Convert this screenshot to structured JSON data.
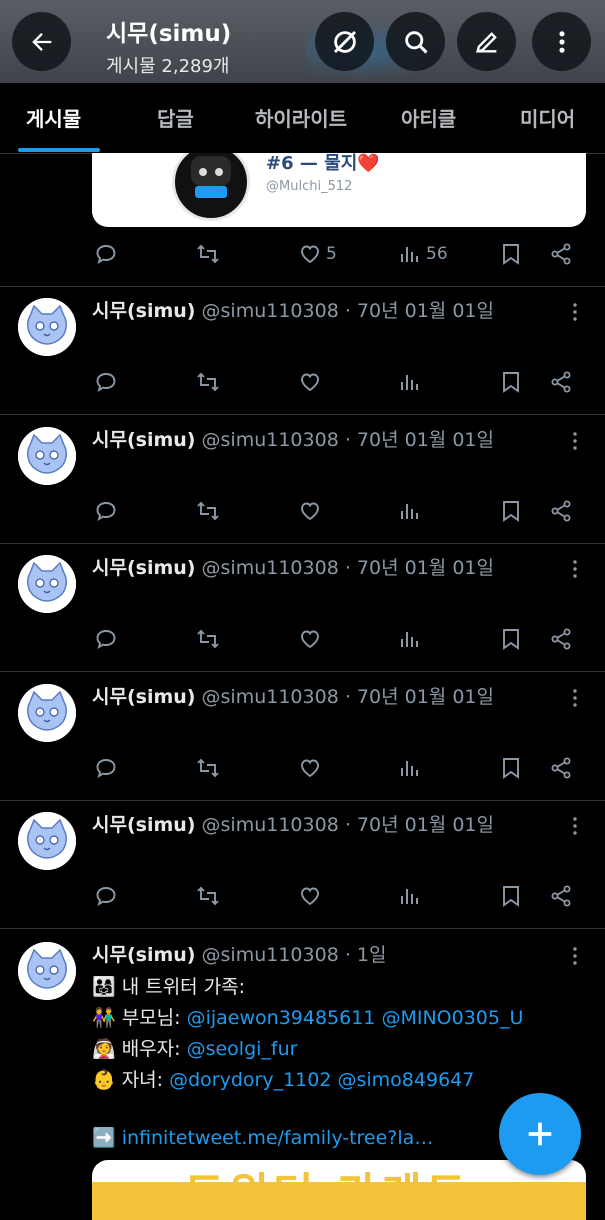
{
  "header": {
    "title": "시무(simu)",
    "post_count": "게시물 2,289개"
  },
  "tabs": [
    {
      "label": "게시물",
      "active": true
    },
    {
      "label": "답글",
      "active": false
    },
    {
      "label": "하이라이트",
      "active": false
    },
    {
      "label": "아티클",
      "active": false
    },
    {
      "label": "미디어",
      "active": false
    }
  ],
  "quoted_card": {
    "title": "#6 — 물지❤️",
    "handle": "@Mulchi_512"
  },
  "first_row_stats": {
    "likes": "5",
    "views": "56"
  },
  "tweets": [
    {
      "name": "시무(simu)",
      "handle": "@simu110308",
      "time": "· 70년 01월 01일"
    },
    {
      "name": "시무(simu)",
      "handle": "@simu110308",
      "time": "· 70년 01월 01일"
    },
    {
      "name": "시무(simu)",
      "handle": "@simu110308",
      "time": "· 70년 01월 01일"
    },
    {
      "name": "시무(simu)",
      "handle": "@simu110308",
      "time": "· 70년 01월 01일"
    },
    {
      "name": "시무(simu)",
      "handle": "@simu110308",
      "time": "· 70년 01월 01일"
    }
  ],
  "family_tweet": {
    "name": "시무(simu)",
    "handle": "@simu110308",
    "time": "· 1일",
    "line1": "👨‍👩‍👧 내 트위터 가족:",
    "parents_label": "👫 부모님:",
    "parent1": "@ijaewon39485611",
    "parent2": "@MINO0305_U",
    "spouse_label": "👰 배우자:",
    "spouse": "@seolgi_fur",
    "children_label": "👶 자녀:",
    "child1": "@dorydory_1102",
    "child2": "@simo849647",
    "link_arrow": "➡️",
    "link": "infinitetweet.me/family-tree?la…",
    "preview_text": "트위터 가계도"
  },
  "colors": {
    "accent": "#1d9bf0",
    "secondary_text": "#8b98a5",
    "divider": "#2f3336"
  }
}
